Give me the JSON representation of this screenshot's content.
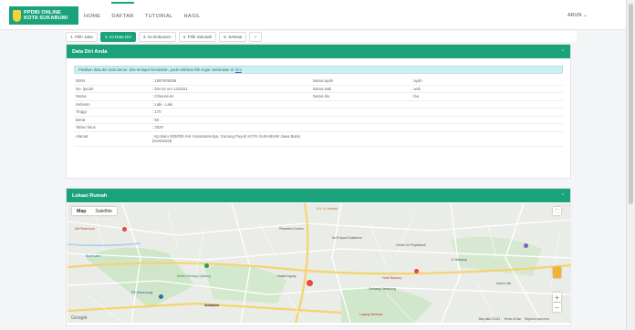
{
  "brand": {
    "line1": "PPDBI ONLINE",
    "line2": "KOTA SUKABUMI"
  },
  "nav": [
    "HOME",
    "DAFTAR",
    "TUTORIAL",
    "HASIL"
  ],
  "user": {
    "name": "ARUN"
  },
  "steps": [
    "1. Pilih Jalur",
    "2. Isi Data Diri",
    "3. Isi Dokumen",
    "4. Pilih Sekolah",
    "5. Selesai"
  ],
  "data_diri": {
    "title": "Data Diri Anda",
    "alert_text": "Pastikan data diri anda benar. Jika terdapat kesalahan, pada silahkan klik segar melakukan di ",
    "alert_link": "Sini",
    "rows": [
      {
        "k1": "NISN",
        "v1": ": 1597605499",
        "k2": "Nama ayah",
        "v2": ": ayah"
      },
      {
        "k1": "No. Ijazah",
        "v1": ": DN-12 um 12/2021",
        "k2": "Nama wali",
        "v2": ": wali"
      },
      {
        "k1": "Nama",
        "v1": ": Cibeureum",
        "k2": "Nama ibu",
        "v2": ": ibu"
      },
      {
        "k1": "Kelamin",
        "v1": ": Laki - Laki",
        "k2": "",
        "v2": ""
      },
      {
        "k1": "Tinggi",
        "v1": ": 170",
        "k2": "",
        "v2": ""
      },
      {
        "k1": "Berat",
        "v1": ": 50",
        "k2": "",
        "v2": ""
      },
      {
        "k1": "Tahun lulus",
        "v1": ": 2020",
        "k2": "",
        "v2": ""
      }
    ],
    "alamat_label": "Alamat",
    "alamat_value": ": Kp.Baru 003/005 Kel. Karamatmulya, Gunung Puyuh KOTA SUKABUMI Jawa Barat (Kamamat)"
  },
  "lokasi": {
    "title": "Lokasi Rumah",
    "map_tab_map": "Map",
    "map_tab_sat": "Satellite",
    "google": "Google",
    "attribution": [
      "Map data ©2021",
      "Terms of Use",
      "Report a map error"
    ],
    "labels": [
      "Jl. Ir. H. Juanda",
      "Pesantren Durren",
      "Ibit Pinamsura",
      "Bumi Lano",
      "Nu'S Ayam Sukabumi",
      "Center for Polykatonil",
      "Hotel Balcony",
      "Gerbang Dehedung",
      "Kolam Renang Cipelang",
      "Masjid Agung",
      "Sukabumi",
      "RS Sekarwangi",
      "Lapang Merdeka",
      "Jl. Siliwangi",
      "Kebon Jati"
    ],
    "colors": {
      "road": "#ffffff",
      "major": "#f5d36e",
      "park": "#c9e7c5",
      "water": "#a9cdee",
      "pin": "#e8473a"
    }
  },
  "colors": {
    "accent": "#1aa37b"
  }
}
